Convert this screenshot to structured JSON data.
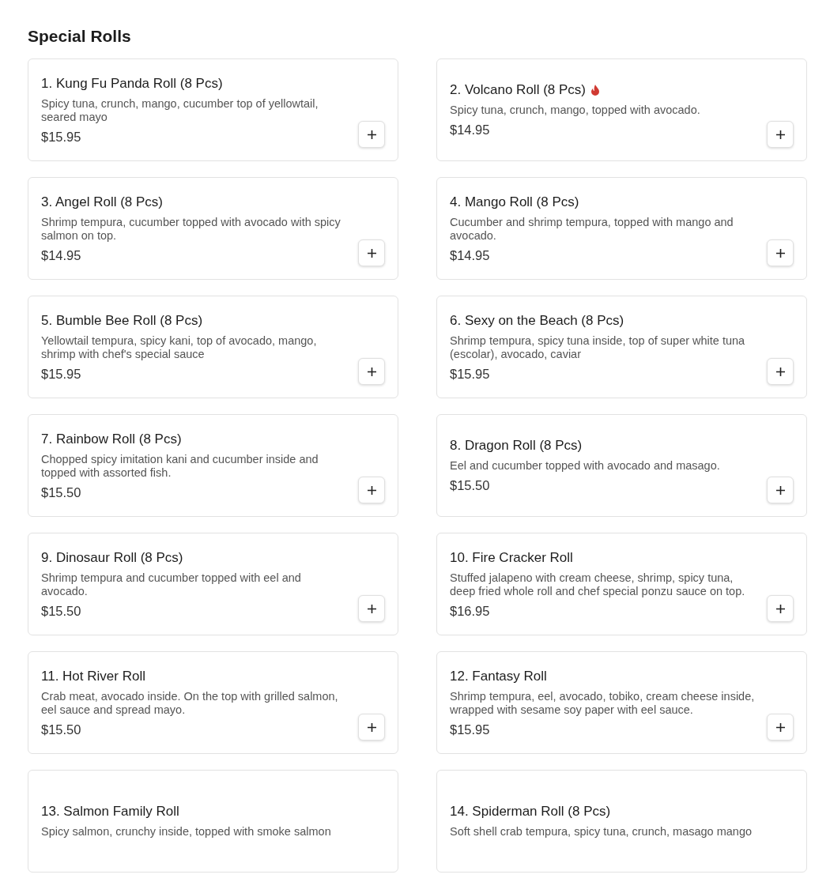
{
  "section": {
    "title": "Special Rolls"
  },
  "items": [
    {
      "name": "1. Kung Fu Panda Roll (8 Pcs)",
      "spicy": false,
      "description": "Spicy tuna, crunch, mango, cucumber top of yellowtail, seared mayo",
      "price": "$15.95"
    },
    {
      "name": "2. Volcano Roll (8 Pcs)",
      "spicy": true,
      "description": "Spicy tuna, crunch, mango, topped with avocado.",
      "price": "$14.95"
    },
    {
      "name": "3. Angel Roll (8 Pcs)",
      "spicy": false,
      "description": "Shrimp tempura, cucumber topped with avocado with spicy salmon on top.",
      "price": "$14.95"
    },
    {
      "name": "4. Mango Roll (8 Pcs)",
      "spicy": false,
      "description": "Cucumber and shrimp tempura, topped with mango and avocado.",
      "price": "$14.95"
    },
    {
      "name": "5. Bumble Bee Roll (8 Pcs)",
      "spicy": false,
      "description": "Yellowtail tempura, spicy kani, top of avocado, mango, shrimp with chef's special sauce",
      "price": "$15.95"
    },
    {
      "name": "6. Sexy on the Beach (8 Pcs)",
      "spicy": false,
      "description": "Shrimp tempura, spicy tuna inside, top of super white tuna (escolar), avocado, caviar",
      "price": "$15.95"
    },
    {
      "name": "7. Rainbow Roll (8 Pcs)",
      "spicy": false,
      "description": "Chopped spicy imitation kani and cucumber inside and topped with assorted fish.",
      "price": "$15.50"
    },
    {
      "name": "8. Dragon Roll (8 Pcs)",
      "spicy": false,
      "description": "Eel and cucumber topped with avocado and masago.",
      "price": "$15.50"
    },
    {
      "name": "9. Dinosaur Roll (8 Pcs)",
      "spicy": false,
      "description": "Shrimp tempura and cucumber topped with eel and avocado.",
      "price": "$15.50"
    },
    {
      "name": "10. Fire Cracker Roll",
      "spicy": false,
      "description": "Stuffed jalapeno with cream cheese, shrimp, spicy tuna, deep fried whole roll and chef special ponzu sauce on top.",
      "price": "$16.95"
    },
    {
      "name": "11. Hot River Roll",
      "spicy": false,
      "description": "Crab meat, avocado inside. On the top with grilled salmon, eel sauce and spread mayo.",
      "price": "$15.50"
    },
    {
      "name": "12. Fantasy Roll",
      "spicy": false,
      "description": "Shrimp tempura, eel, avocado, tobiko, cream cheese inside, wrapped with sesame soy paper with eel sauce.",
      "price": "$15.95"
    },
    {
      "name": "13. Salmon Family Roll",
      "spicy": false,
      "description": "Spicy salmon, crunchy inside, topped with smoke salmon"
    },
    {
      "name": "14. Spiderman Roll (8 Pcs)",
      "spicy": false,
      "description": "Soft shell crab tempura, spicy tuna, crunch, masago mango"
    }
  ]
}
